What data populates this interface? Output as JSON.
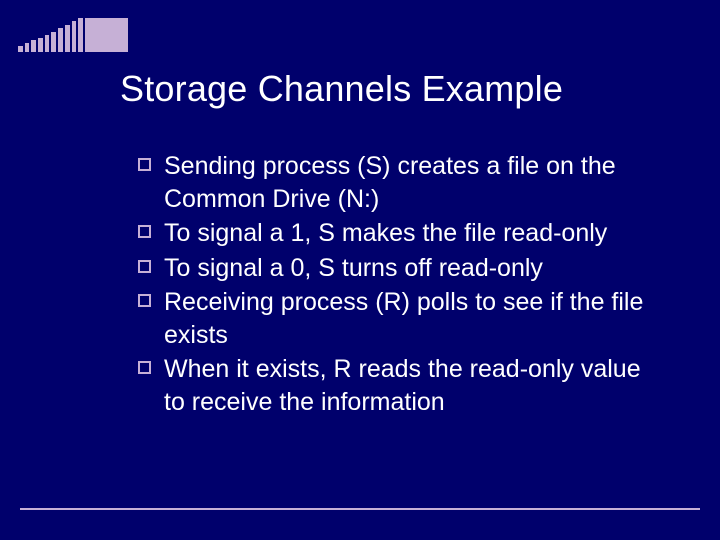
{
  "title": "Storage Channels Example",
  "bullets": [
    "Sending process (S) creates a file on the Common Drive (N:)",
    "To signal a 1, S makes the file read-only",
    "To signal a 0, S turns off read-only",
    "Receiving process (R) polls to see if the file exists",
    "When it exists, R reads the read-only value to receive the information"
  ]
}
